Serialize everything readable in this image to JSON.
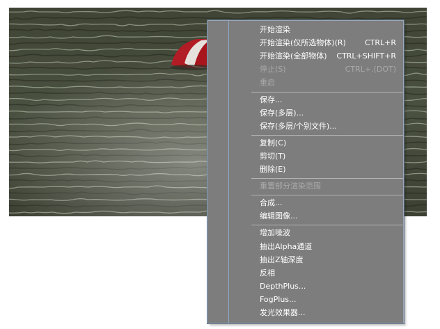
{
  "render_view": {
    "description_icon": "rendered-ocean-image"
  },
  "menu": {
    "groups": [
      {
        "items": [
          {
            "label": "开始渲染",
            "shortcut": "",
            "enabled": true
          },
          {
            "label": "开始渲染(仅所选物体)(R)",
            "shortcut": "CTRL+R",
            "enabled": true
          },
          {
            "label": "开始渲染(全部物体)",
            "shortcut": "CTRL+SHIFT+R",
            "enabled": true
          },
          {
            "label": "停止(S)",
            "shortcut": "CTRL+.(DOT)",
            "enabled": false
          },
          {
            "label": "重启",
            "shortcut": "",
            "enabled": false
          }
        ]
      },
      {
        "items": [
          {
            "label": "保存...",
            "shortcut": "",
            "enabled": true
          },
          {
            "label": "保存(多层)...",
            "shortcut": "",
            "enabled": true
          },
          {
            "label": "保存(多层/个别文件)...",
            "shortcut": "",
            "enabled": true
          }
        ]
      },
      {
        "items": [
          {
            "label": "复制(C)",
            "shortcut": "",
            "enabled": true
          },
          {
            "label": "剪切(T)",
            "shortcut": "",
            "enabled": true
          },
          {
            "label": "删除(E)",
            "shortcut": "",
            "enabled": true
          }
        ]
      },
      {
        "items": [
          {
            "label": "重置部分渲染范围",
            "shortcut": "",
            "enabled": false
          }
        ]
      },
      {
        "items": [
          {
            "label": "合成...",
            "shortcut": "",
            "enabled": true
          },
          {
            "label": "编辑图像...",
            "shortcut": "",
            "enabled": true
          }
        ]
      },
      {
        "items": [
          {
            "label": "增加噪波",
            "shortcut": "",
            "enabled": true
          },
          {
            "label": "抽出Alpha通道",
            "shortcut": "",
            "enabled": true
          },
          {
            "label": "抽出Z轴深度",
            "shortcut": "",
            "enabled": true
          },
          {
            "label": "反相",
            "shortcut": "",
            "enabled": true
          },
          {
            "label": "DepthPlus...",
            "shortcut": "",
            "enabled": true
          },
          {
            "label": "FogPlus...",
            "shortcut": "",
            "enabled": true
          },
          {
            "label": "发光效果器...",
            "shortcut": "",
            "enabled": true
          }
        ]
      }
    ]
  }
}
